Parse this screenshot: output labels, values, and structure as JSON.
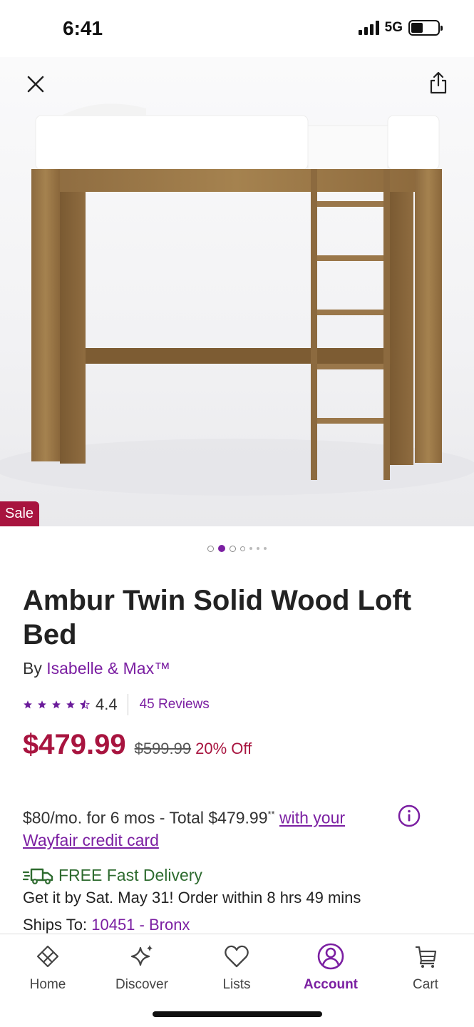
{
  "status": {
    "time": "6:41",
    "network": "5G",
    "battery_level": 0.45
  },
  "hero": {
    "badge": "Sale",
    "image_count_indicators": 7,
    "active_indicator": 1
  },
  "product": {
    "title": "Ambur Twin Solid Wood Loft Bed",
    "by_prefix": "By",
    "brand": "Isabelle & Max™",
    "rating": "4.4",
    "rating_value": 4.4,
    "reviews": "45 Reviews",
    "price": "$479.99",
    "old_price": "$599.99",
    "discount": "20% Off"
  },
  "financing": {
    "text": "$80/mo. for 6 mos - Total $479.99",
    "footnote": "**",
    "link_text": "with your Wayfair credit card"
  },
  "delivery": {
    "label": "FREE Fast Delivery",
    "get_by": "Get it by Sat. May 31! Order within 8 hrs 49 mins",
    "ships_prefix": "Ships To:",
    "ships_location": "10451 - Bronx"
  },
  "tabs": [
    {
      "label": "Home",
      "icon": "home-icon",
      "active": false
    },
    {
      "label": "Discover",
      "icon": "sparkle-icon",
      "active": false
    },
    {
      "label": "Lists",
      "icon": "heart-icon",
      "active": false
    },
    {
      "label": "Account",
      "icon": "account-icon",
      "active": true
    },
    {
      "label": "Cart",
      "icon": "cart-icon",
      "active": false
    }
  ],
  "colors": {
    "accent": "#7b1fa2",
    "sale": "#a8143f",
    "delivery": "#2e6b2f"
  }
}
